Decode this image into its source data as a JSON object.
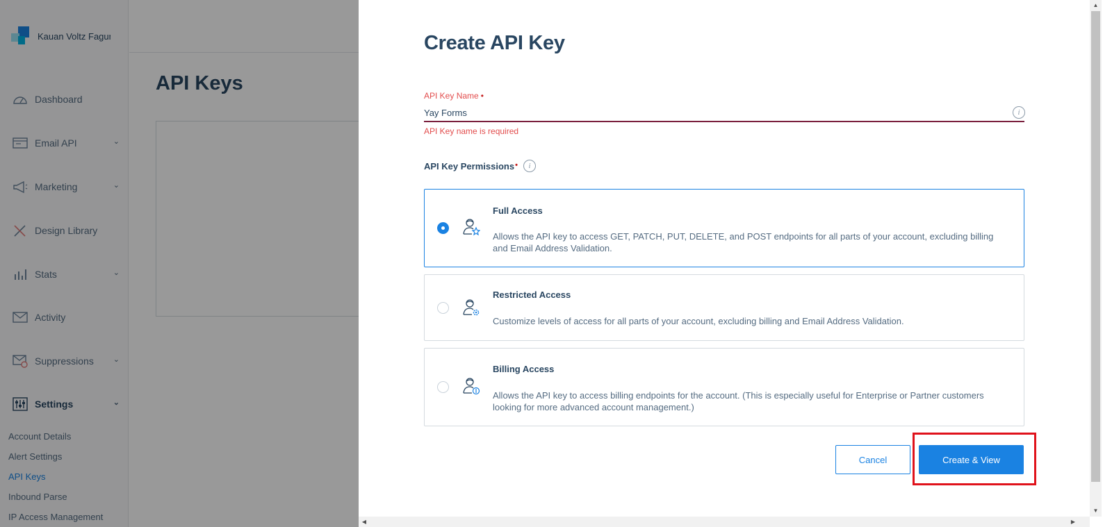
{
  "sidebar": {
    "account_name": "Kauan Voltz Fagun",
    "nav": [
      {
        "label": "Dashboard"
      },
      {
        "label": "Email API"
      },
      {
        "label": "Marketing"
      },
      {
        "label": "Design Library"
      },
      {
        "label": "Stats"
      },
      {
        "label": "Activity"
      },
      {
        "label": "Suppressions"
      },
      {
        "label": "Settings"
      }
    ],
    "settings_sub": [
      {
        "label": "Account Details"
      },
      {
        "label": "Alert Settings"
      },
      {
        "label": "API Keys"
      },
      {
        "label": "Inbound Parse"
      },
      {
        "label": "IP Access Management"
      }
    ]
  },
  "page": {
    "title": "API Keys"
  },
  "modal": {
    "title": "Create API Key",
    "name_field": {
      "label": "API Key Name",
      "required_mark": "•",
      "value": "Yay Forms",
      "error": "API Key name is required",
      "info_glyph": "i"
    },
    "permissions": {
      "label": "API Key Permissions",
      "required_mark": "•",
      "info_glyph": "i",
      "selected": "full",
      "options": [
        {
          "id": "full",
          "title": "Full Access",
          "description": "Allows the API key to access GET, PATCH, PUT, DELETE, and POST endpoints for all parts of your account, excluding billing and Email Address Validation.",
          "icon": "user-star-icon"
        },
        {
          "id": "restricted",
          "title": "Restricted Access",
          "description": "Customize levels of access for all parts of your account, excluding billing and Email Address Validation.",
          "icon": "user-gear-icon"
        },
        {
          "id": "billing",
          "title": "Billing Access",
          "description": "Allows the API key to access billing endpoints for the account. (This is especially useful for Enterprise or Partner customers looking for more advanced account management.)",
          "icon": "user-dollar-icon"
        }
      ]
    },
    "buttons": {
      "cancel": "Cancel",
      "create": "Create & View"
    }
  },
  "colors": {
    "primary": "#1a82e2",
    "error": "#e24c4c",
    "text_dark": "#294661",
    "highlight": "#e0121b"
  }
}
